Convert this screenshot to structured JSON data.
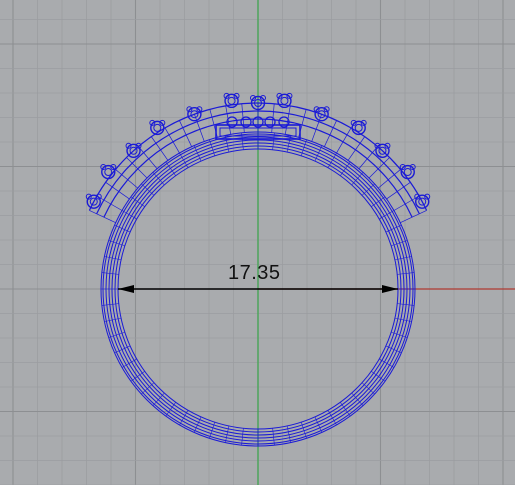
{
  "viewport": {
    "background": "#a9abae",
    "grid_minor_color": "#9b9da0",
    "grid_major_color": "#8d8f92",
    "y_axis_color": "#3aa64a",
    "x_axis_color": "#b03a32",
    "wireframe_color": "#1a1ad6",
    "dimension_color": "#000000"
  },
  "dimension": {
    "value_label": "17.35"
  },
  "model": {
    "object": "ring",
    "display_mode": "wireframe"
  }
}
